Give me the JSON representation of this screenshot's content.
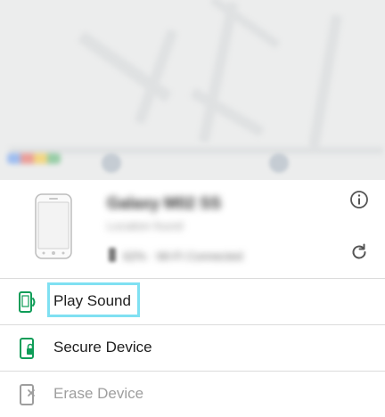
{
  "colors": {
    "accent_green": "#0f9d58",
    "disabled_gray": "#9e9e9e",
    "highlight_cyan": "#7fe0f2",
    "divider": "#dcdcdc"
  },
  "device": {
    "name": "Galaxy M02 SS",
    "subtitle": "Location found",
    "battery": "62%  ·  Wi-Fi Connected",
    "image_icon": "phone-image",
    "info_icon": "info-icon",
    "refresh_icon": "refresh-icon"
  },
  "actions": [
    {
      "label": "Play Sound",
      "icon": "phone-sound-icon",
      "state": "highlighted"
    },
    {
      "label": "Secure Device",
      "icon": "phone-lock-icon",
      "state": "enabled"
    },
    {
      "label": "Erase Device",
      "icon": "phone-erase-icon",
      "state": "disabled"
    }
  ]
}
